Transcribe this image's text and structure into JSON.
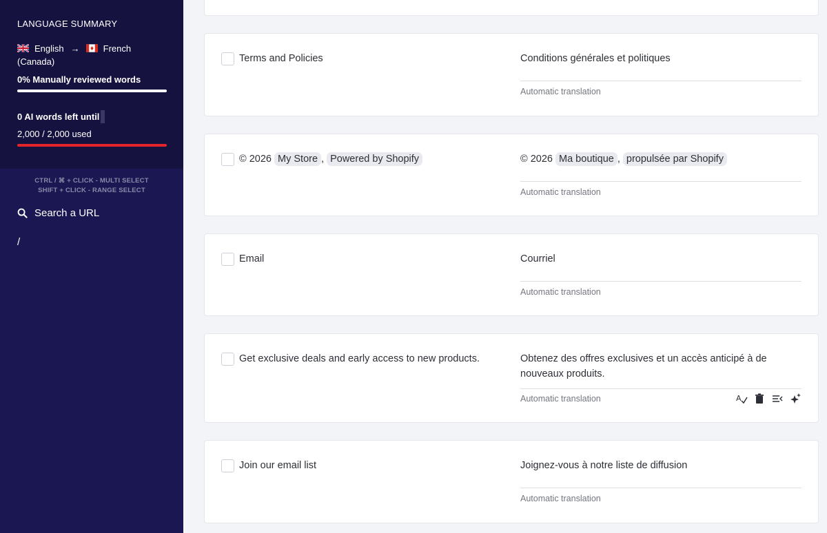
{
  "sidebar": {
    "summary_title": "LANGUAGE SUMMARY",
    "source_language": "English",
    "target_language": "French",
    "target_region": "(Canada)",
    "reviewed_label": "0% Manually reviewed words",
    "reviewed_progress": 1.0,
    "ai_words_label": "0 AI words left until",
    "ai_used_label": "2,000 / 2,000 used",
    "ai_used_progress": 1.0,
    "hint_line1": "CTRL / ⌘ + CLICK - MULTI SELECT",
    "hint_line2": "SHIFT + CLICK - RANGE SELECT",
    "search_label": "Search a URL",
    "root_path": "/"
  },
  "rows": [
    {
      "source": "Terms and Policies",
      "target": "Conditions générales et politiques",
      "status": "Automatic translation"
    },
    {
      "source_prefix": "© 2026",
      "source_chip1": "My Store",
      "source_sep": ",",
      "source_chip2": "Powered by Shopify",
      "target_prefix": "© 2026",
      "target_chip1": "Ma boutique",
      "target_sep": ",",
      "target_chip2": "propulsée par Shopify",
      "status": "Automatic translation"
    },
    {
      "source": "Email",
      "target": "Courriel",
      "status": "Automatic translation"
    },
    {
      "source": "Get exclusive deals and early access to new products.",
      "target": "Obtenez des offres exclusives et un accès anticipé à de nouveaux produits.",
      "status": "Automatic translation"
    },
    {
      "source": "Join our email list",
      "target": "Joignez-vous à notre liste de diffusion",
      "status": "Automatic translation"
    }
  ],
  "row_tools": [
    "spellcheck-icon",
    "trash-icon",
    "text-align-icon",
    "sparkle-icon"
  ],
  "colors": {
    "sidebar_bg": "#1b1752",
    "summary_bg": "#15123f",
    "progress_red": "#e3242b"
  }
}
